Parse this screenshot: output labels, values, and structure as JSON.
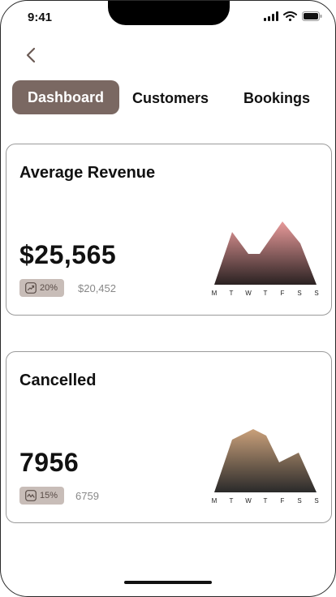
{
  "status": {
    "time": "9:41"
  },
  "tabs": [
    {
      "label": "Dashboard",
      "active": true
    },
    {
      "label": "Customers",
      "active": false
    },
    {
      "label": "Bookings",
      "active": false
    }
  ],
  "cards": [
    {
      "title": "Average Revenue",
      "value": "$25,565",
      "change": "20%",
      "change_icon": "trending-up-icon",
      "previous": "$20,452",
      "chart_data": {
        "type": "area",
        "categories": [
          "M",
          "T",
          "W",
          "T",
          "F",
          "S",
          "S"
        ],
        "colors": {
          "top": "#e89a9a",
          "bottom": "#2a2222"
        }
      }
    },
    {
      "title": "Cancelled",
      "value": "7956",
      "change": "15%",
      "change_icon": "trend-wave-icon",
      "previous": "6759",
      "chart_data": {
        "type": "area",
        "categories": [
          "M",
          "T",
          "W",
          "T",
          "F",
          "S",
          "S"
        ],
        "colors": {
          "top": "#c9a07a",
          "bottom": "#2a2a2a"
        }
      }
    }
  ]
}
